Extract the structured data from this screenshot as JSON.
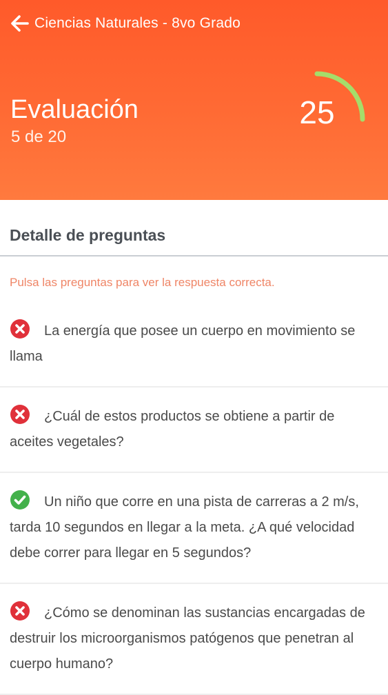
{
  "header": {
    "course_title": "Ciencias Naturales - 8vo Grado",
    "evaluation_title": "Evaluación",
    "progress_text": "5 de 20",
    "score": "25",
    "score_fraction": 0.25,
    "colors": {
      "header_bg": "#ff6230",
      "score_arc": "#a5dd6a"
    }
  },
  "details": {
    "heading": "Detalle de preguntas",
    "hint": "Pulsa las preguntas para ver la respuesta correcta."
  },
  "questions": [
    {
      "status": "incorrect",
      "icon": "x-circle-icon",
      "text": "La energía que posee un cuerpo en movimiento se llama"
    },
    {
      "status": "incorrect",
      "icon": "x-circle-icon",
      "text": "¿Cuál de estos productos se obtiene a partir de aceites vegetales?"
    },
    {
      "status": "correct",
      "icon": "check-circle-icon",
      "text": "Un niño que corre en una pista de carreras a 2 m/s, tarda 10 segundos en llegar a la meta. ¿A qué velocidad debe correr para llegar en 5 segundos?"
    },
    {
      "status": "incorrect",
      "icon": "x-circle-icon",
      "text": "¿Cómo se denominan las sustancias encargadas de destruir los microorganismos patógenos que penetran al cuerpo humano?"
    }
  ],
  "status_colors": {
    "incorrect": "#e0313a",
    "correct": "#43b14b"
  }
}
